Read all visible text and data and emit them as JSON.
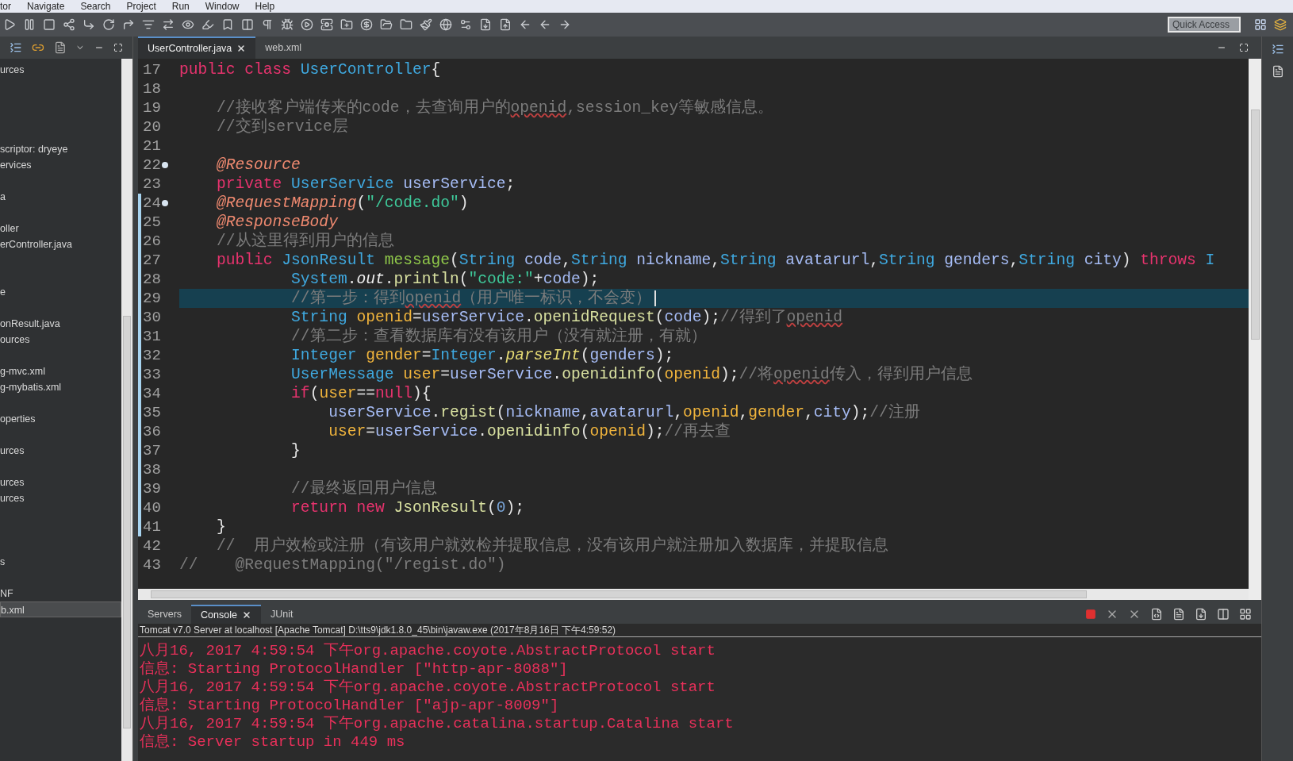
{
  "menu": [
    "tor",
    "Navigate",
    "Search",
    "Project",
    "Run",
    "Window",
    "Help"
  ],
  "quick_access": {
    "placeholder": "Quick Access"
  },
  "explorer": {
    "rows": [
      {
        "kind": "item",
        "text": "urces",
        "selected": false
      },
      {
        "kind": "blank"
      },
      {
        "kind": "blank"
      },
      {
        "kind": "blank"
      },
      {
        "kind": "blank"
      },
      {
        "kind": "item",
        "text": "scriptor: dryeye",
        "selected": false
      },
      {
        "kind": "item",
        "text": "ervices",
        "selected": false
      },
      {
        "kind": "blank"
      },
      {
        "kind": "item",
        "text": "a",
        "selected": false
      },
      {
        "kind": "blank"
      },
      {
        "kind": "item",
        "text": "oller",
        "selected": false
      },
      {
        "kind": "item",
        "text": "erController.java",
        "selected": false
      },
      {
        "kind": "blank"
      },
      {
        "kind": "blank"
      },
      {
        "kind": "item",
        "text": "e",
        "selected": false
      },
      {
        "kind": "blank"
      },
      {
        "kind": "item",
        "text": "onResult.java",
        "selected": false
      },
      {
        "kind": "item",
        "text": "ources",
        "selected": false
      },
      {
        "kind": "blank"
      },
      {
        "kind": "item",
        "text": "g-mvc.xml",
        "selected": false
      },
      {
        "kind": "item",
        "text": "g-mybatis.xml",
        "selected": false
      },
      {
        "kind": "blank"
      },
      {
        "kind": "item",
        "text": "operties",
        "selected": false
      },
      {
        "kind": "blank"
      },
      {
        "kind": "item",
        "text": "urces",
        "selected": false
      },
      {
        "kind": "blank"
      },
      {
        "kind": "item",
        "text": "urces",
        "selected": false
      },
      {
        "kind": "item",
        "text": "urces",
        "selected": false
      },
      {
        "kind": "blank"
      },
      {
        "kind": "blank"
      },
      {
        "kind": "blank"
      },
      {
        "kind": "item",
        "text": "s",
        "selected": false
      },
      {
        "kind": "blank"
      },
      {
        "kind": "item",
        "text": "NF",
        "selected": false
      },
      {
        "kind": "item",
        "text": "b.xml",
        "selected": true
      }
    ]
  },
  "editor": {
    "tabs": [
      {
        "label": "UserController.java",
        "selected": true,
        "closable": true
      },
      {
        "label": "web.xml",
        "selected": false,
        "closable": false
      }
    ],
    "lines": [
      {
        "number": "17",
        "fold": false,
        "changed": false,
        "current": false,
        "tokens": [
          {
            "text": "public class ",
            "kind": "kw"
          },
          {
            "text": "UserController",
            "kind": "type"
          },
          {
            "text": "{",
            "kind": "plain"
          }
        ]
      },
      {
        "number": "18",
        "fold": false,
        "changed": false,
        "current": false
      },
      {
        "number": "19",
        "fold": false,
        "changed": false,
        "current": false,
        "tokens": [
          {
            "text": "    //接收客户端传来的code，去查询用户的",
            "kind": "comment"
          },
          {
            "text": "openid",
            "kind": "typo"
          },
          {
            "text": ",session_key等敏感信息。",
            "kind": "comment"
          }
        ]
      },
      {
        "number": "20",
        "fold": false,
        "changed": false,
        "current": false,
        "tokens": [
          {
            "text": "    //交到service层",
            "kind": "comment"
          }
        ]
      },
      {
        "number": "21",
        "fold": false,
        "changed": false,
        "current": false
      },
      {
        "number": "22",
        "fold": true,
        "changed": false,
        "current": false,
        "tokens": [
          {
            "text": "    @Resource",
            "kind": "anno"
          }
        ]
      },
      {
        "number": "23",
        "fold": false,
        "changed": false,
        "current": false,
        "tokens": [
          {
            "text": "    private ",
            "kind": "kw"
          },
          {
            "text": "UserService ",
            "kind": "type"
          },
          {
            "text": "userService",
            "kind": "var"
          },
          {
            "text": ";",
            "kind": "plain"
          }
        ]
      },
      {
        "number": "24",
        "fold": true,
        "changed": true,
        "current": false,
        "tokens": [
          {
            "text": "    @RequestMapping",
            "kind": "anno"
          },
          {
            "text": "(",
            "kind": "plain"
          },
          {
            "text": "\"/code.do\"",
            "kind": "string"
          },
          {
            "text": ")",
            "kind": "plain"
          }
        ]
      },
      {
        "number": "25",
        "fold": false,
        "changed": true,
        "current": false,
        "tokens": [
          {
            "text": "    @ResponseBody",
            "kind": "anno"
          }
        ]
      },
      {
        "number": "26",
        "fold": false,
        "changed": true,
        "current": false,
        "tokens": [
          {
            "text": "    //从这里得到用户的信息",
            "kind": "comment"
          }
        ]
      },
      {
        "number": "27",
        "fold": false,
        "changed": true,
        "current": false,
        "tokens": [
          {
            "text": "    public ",
            "kind": "kw"
          },
          {
            "text": "JsonResult ",
            "kind": "type"
          },
          {
            "text": "message",
            "kind": "decl"
          },
          {
            "text": "(",
            "kind": "plain"
          },
          {
            "text": "String ",
            "kind": "type"
          },
          {
            "text": "code",
            "kind": "var"
          },
          {
            "text": ",",
            "kind": "plain"
          },
          {
            "text": "String ",
            "kind": "type"
          },
          {
            "text": "nickname",
            "kind": "var"
          },
          {
            "text": ",",
            "kind": "plain"
          },
          {
            "text": "String ",
            "kind": "type"
          },
          {
            "text": "avatarurl",
            "kind": "var"
          },
          {
            "text": ",",
            "kind": "plain"
          },
          {
            "text": "String ",
            "kind": "type"
          },
          {
            "text": "genders",
            "kind": "var"
          },
          {
            "text": ",",
            "kind": "plain"
          },
          {
            "text": "String ",
            "kind": "type"
          },
          {
            "text": "city",
            "kind": "var"
          },
          {
            "text": ") ",
            "kind": "plain"
          },
          {
            "text": "throws ",
            "kind": "kw"
          },
          {
            "text": "I",
            "kind": "type"
          }
        ]
      },
      {
        "number": "28",
        "fold": false,
        "changed": true,
        "current": false,
        "tokens": [
          {
            "text": "            System",
            "kind": "type"
          },
          {
            "text": ".",
            "kind": "plain"
          },
          {
            "text": "out",
            "kind": "static"
          },
          {
            "text": ".",
            "kind": "plain"
          },
          {
            "text": "println",
            "kind": "method"
          },
          {
            "text": "(",
            "kind": "plain"
          },
          {
            "text": "\"code:\"",
            "kind": "string"
          },
          {
            "text": "+",
            "kind": "plain"
          },
          {
            "text": "code",
            "kind": "var"
          },
          {
            "text": ");",
            "kind": "plain"
          }
        ]
      },
      {
        "number": "29",
        "fold": false,
        "changed": true,
        "current": true,
        "tokens": [
          {
            "text": "            //第一步：得到",
            "kind": "comment"
          },
          {
            "text": "openid",
            "kind": "typo"
          },
          {
            "text": "（用户唯一标识，不会变）",
            "kind": "comment"
          }
        ]
      },
      {
        "number": "30",
        "fold": false,
        "changed": true,
        "current": false,
        "tokens": [
          {
            "text": "            String ",
            "kind": "type"
          },
          {
            "text": "openid",
            "kind": "local"
          },
          {
            "text": "=",
            "kind": "plain"
          },
          {
            "text": "userService",
            "kind": "var"
          },
          {
            "text": ".",
            "kind": "plain"
          },
          {
            "text": "openidRequest",
            "kind": "method"
          },
          {
            "text": "(",
            "kind": "plain"
          },
          {
            "text": "code",
            "kind": "var"
          },
          {
            "text": ");",
            "kind": "plain"
          },
          {
            "text": "//得到了",
            "kind": "comment"
          },
          {
            "text": "openid",
            "kind": "typo"
          }
        ]
      },
      {
        "number": "31",
        "fold": false,
        "changed": true,
        "current": false,
        "tokens": [
          {
            "text": "            //第二步：查看数据库有没有该用户（没有就注册，有就）",
            "kind": "comment"
          }
        ]
      },
      {
        "number": "32",
        "fold": false,
        "changed": true,
        "current": false,
        "tokens": [
          {
            "text": "            Integer ",
            "kind": "type"
          },
          {
            "text": "gender",
            "kind": "local"
          },
          {
            "text": "=",
            "kind": "plain"
          },
          {
            "text": "Integer",
            "kind": "type"
          },
          {
            "text": ".",
            "kind": "plain"
          },
          {
            "text": "parseInt",
            "kind": "staticm"
          },
          {
            "text": "(",
            "kind": "plain"
          },
          {
            "text": "genders",
            "kind": "var"
          },
          {
            "text": ");",
            "kind": "plain"
          }
        ]
      },
      {
        "number": "33",
        "fold": false,
        "changed": true,
        "current": false,
        "tokens": [
          {
            "text": "            UserMessage ",
            "kind": "type"
          },
          {
            "text": "user",
            "kind": "local"
          },
          {
            "text": "=",
            "kind": "plain"
          },
          {
            "text": "userService",
            "kind": "var"
          },
          {
            "text": ".",
            "kind": "plain"
          },
          {
            "text": "openidinfo",
            "kind": "method"
          },
          {
            "text": "(",
            "kind": "plain"
          },
          {
            "text": "openid",
            "kind": "local"
          },
          {
            "text": ");",
            "kind": "plain"
          },
          {
            "text": "//将",
            "kind": "comment"
          },
          {
            "text": "openid",
            "kind": "typo"
          },
          {
            "text": "传入，得到用户信息",
            "kind": "comment"
          }
        ]
      },
      {
        "number": "34",
        "fold": false,
        "changed": true,
        "current": false,
        "tokens": [
          {
            "text": "            if",
            "kind": "kw"
          },
          {
            "text": "(",
            "kind": "plain"
          },
          {
            "text": "user",
            "kind": "local"
          },
          {
            "text": "==",
            "kind": "plain"
          },
          {
            "text": "null",
            "kind": "kw"
          },
          {
            "text": "){",
            "kind": "plain"
          }
        ]
      },
      {
        "number": "35",
        "fold": false,
        "changed": true,
        "current": false,
        "tokens": [
          {
            "text": "                userService",
            "kind": "var"
          },
          {
            "text": ".",
            "kind": "plain"
          },
          {
            "text": "regist",
            "kind": "method"
          },
          {
            "text": "(",
            "kind": "plain"
          },
          {
            "text": "nickname",
            "kind": "var"
          },
          {
            "text": ",",
            "kind": "plain"
          },
          {
            "text": "avatarurl",
            "kind": "var"
          },
          {
            "text": ",",
            "kind": "plain"
          },
          {
            "text": "openid",
            "kind": "local"
          },
          {
            "text": ",",
            "kind": "plain"
          },
          {
            "text": "gender",
            "kind": "local"
          },
          {
            "text": ",",
            "kind": "plain"
          },
          {
            "text": "city",
            "kind": "var"
          },
          {
            "text": ");",
            "kind": "plain"
          },
          {
            "text": "//注册",
            "kind": "comment"
          }
        ]
      },
      {
        "number": "36",
        "fold": false,
        "changed": true,
        "current": false,
        "tokens": [
          {
            "text": "                user",
            "kind": "local"
          },
          {
            "text": "=",
            "kind": "plain"
          },
          {
            "text": "userService",
            "kind": "var"
          },
          {
            "text": ".",
            "kind": "plain"
          },
          {
            "text": "openidinfo",
            "kind": "method"
          },
          {
            "text": "(",
            "kind": "plain"
          },
          {
            "text": "openid",
            "kind": "local"
          },
          {
            "text": ");",
            "kind": "plain"
          },
          {
            "text": "//再去查",
            "kind": "comment"
          }
        ]
      },
      {
        "number": "37",
        "fold": false,
        "changed": true,
        "current": false,
        "tokens": [
          {
            "text": "            }",
            "kind": "plain"
          }
        ]
      },
      {
        "number": "38",
        "fold": false,
        "changed": true,
        "current": false
      },
      {
        "number": "39",
        "fold": false,
        "changed": true,
        "current": false,
        "tokens": [
          {
            "text": "            //最终返回用户信息",
            "kind": "comment"
          }
        ]
      },
      {
        "number": "40",
        "fold": false,
        "changed": true,
        "current": false,
        "tokens": [
          {
            "text": "            return new ",
            "kind": "kw"
          },
          {
            "text": "JsonResult",
            "kind": "method"
          },
          {
            "text": "(",
            "kind": "plain"
          },
          {
            "text": "0",
            "kind": "number"
          },
          {
            "text": ");",
            "kind": "plain"
          }
        ]
      },
      {
        "number": "41",
        "fold": false,
        "changed": true,
        "current": false,
        "tokens": [
          {
            "text": "    }",
            "kind": "plain"
          }
        ]
      },
      {
        "number": "42",
        "fold": false,
        "changed": false,
        "current": false,
        "tokens": [
          {
            "text": "    //  用户效检或注册（有该用户就效检并提取信息，没有该用户就注册加入数据库，并提取信息",
            "kind": "comment"
          }
        ]
      },
      {
        "number": "43",
        "fold": false,
        "changed": false,
        "current": false,
        "tokens": [
          {
            "text": "//    @RequestMapping(\"/regist.do\")",
            "kind": "comment"
          }
        ]
      }
    ]
  },
  "console": {
    "tabs": [
      {
        "label": "Servers",
        "selected": false,
        "closable": false
      },
      {
        "label": "Console",
        "selected": true,
        "closable": true
      },
      {
        "label": "JUnit",
        "selected": false,
        "closable": false
      }
    ],
    "header": "Tomcat v7.0 Server at localhost [Apache Tomcat] D:\\tts9\\jdk1.8.0_45\\bin\\javaw.exe (2017年8月16日 下午4:59:52)",
    "lines": [
      "八月16, 2017 4:59:54 下午org.apache.coyote.AbstractProtocol start",
      "信息: Starting ProtocolHandler [\"http-apr-8088\"]",
      "八月16, 2017 4:59:54 下午org.apache.coyote.AbstractProtocol start",
      "信息: Starting ProtocolHandler [\"ajp-apr-8009\"]",
      "八月16, 2017 4:59:54 下午org.apache.catalina.startup.Catalina start",
      "信息: Server startup in 449 ms"
    ]
  }
}
